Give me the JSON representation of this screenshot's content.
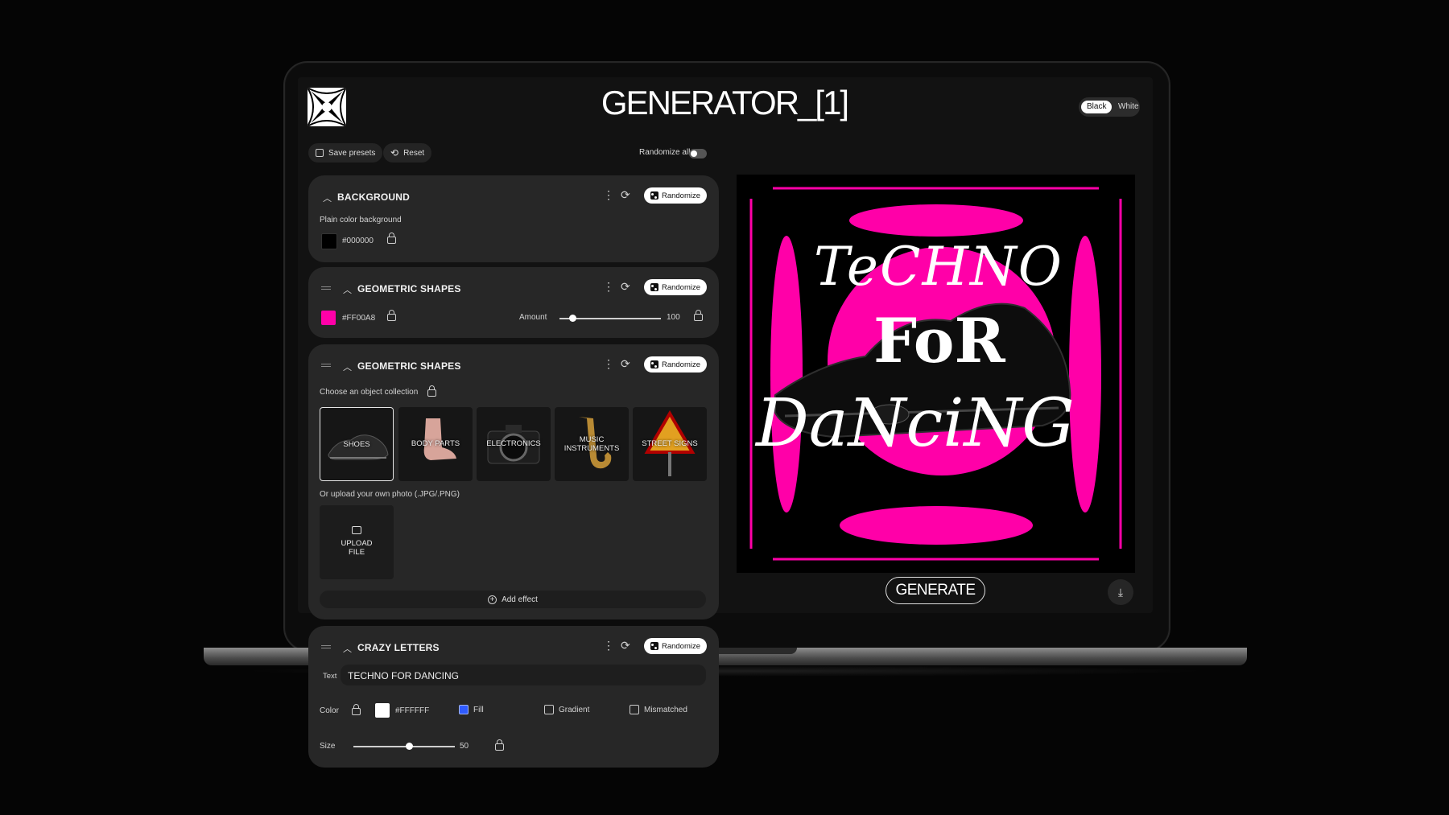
{
  "header": {
    "title": "GENERATOR_[1]",
    "theme_options": [
      "Black",
      "White"
    ],
    "theme_selected": "Black"
  },
  "toolbar": {
    "save_label": "Save presets",
    "reset_label": "Reset",
    "randomize_all_label": "Randomize all",
    "randomize_all_on": false
  },
  "panels": {
    "background": {
      "title": "BACKGROUND",
      "subtitle": "Plain color background",
      "color": "#000000",
      "randomize_label": "Randomize"
    },
    "shapes": {
      "title": "GEOMETRIC SHAPES",
      "color": "#FF00A8",
      "amount_label": "Amount",
      "amount_value": "100",
      "amount_fraction": 0.13,
      "randomize_label": "Randomize"
    },
    "objects": {
      "title": "GEOMETRIC SHAPES",
      "subtitle": "Choose an object collection",
      "collections": [
        "SHOES",
        "BODY PARTS",
        "ELECTRONICS",
        "MUSIC INSTRUMENTS",
        "STREET SIGNS"
      ],
      "selected": "SHOES",
      "upload_hint": "Or upload your own photo (.JPG/.PNG)",
      "upload_label": "UPLOAD FILE",
      "add_effect_label": "Add effect",
      "randomize_label": "Randomize"
    },
    "letters": {
      "title": "CRAZY LETTERS",
      "text_label": "Text",
      "text_value": "TECHNO FOR DANCING",
      "color_label": "Color",
      "color": "#FFFFFF",
      "fill_label": "Fill",
      "fill_on": true,
      "gradient_label": "Gradient",
      "gradient_on": false,
      "mismatched_label": "Mismatched",
      "mismatched_on": false,
      "size_label": "Size",
      "size_value": "50",
      "size_fraction": 0.55,
      "randomize_label": "Randomize"
    }
  },
  "preview": {
    "line1": "TeCHNO",
    "line2": "FoR",
    "line3": "DaNciNG",
    "accent": "#FF00A8"
  },
  "generate_label": "GENERATE",
  "icons": [
    "logo-icon",
    "save-icon",
    "reset-icon",
    "kebab-icon",
    "reload-icon",
    "dice-icon",
    "lock-icon",
    "chevron-up-icon",
    "drag-handle-icon",
    "add-image-icon",
    "add-circle-icon",
    "download-icon"
  ]
}
